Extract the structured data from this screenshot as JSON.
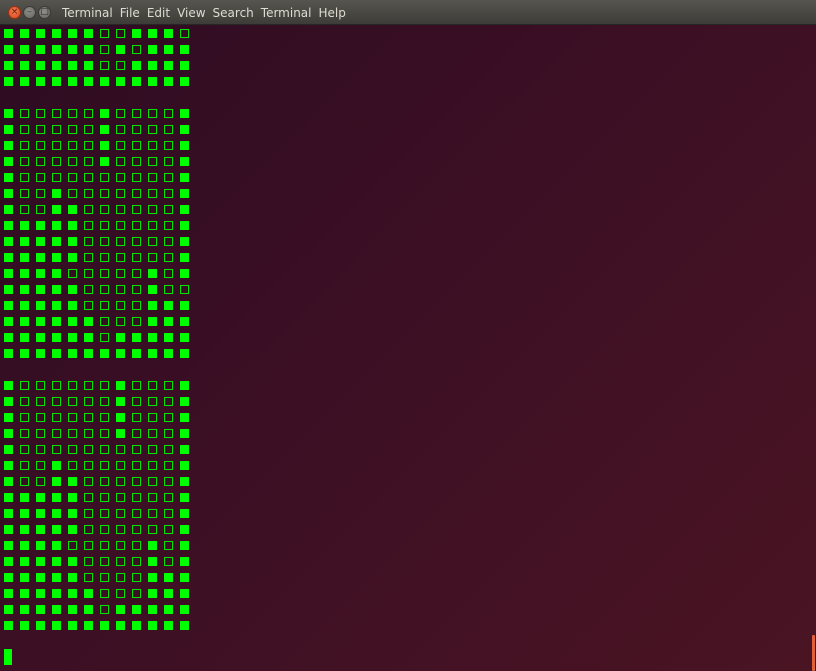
{
  "window": {
    "title_icons": {
      "close": "close-icon",
      "minimize": "minimize-icon",
      "maximize": "maximize-icon"
    }
  },
  "menubar": {
    "items": [
      "Terminal",
      "File",
      "Edit",
      "View",
      "Search",
      "Terminal",
      "Help"
    ]
  },
  "terminal": {
    "fg_color": "#00ff00",
    "blocks": [
      {
        "rows": [
          "111111001110",
          "111111010111",
          "111111001111",
          "111111111111"
        ]
      },
      {
        "rows": [
          "100000100001",
          "100000100001",
          "100000100001",
          "100000100001",
          "100000000001",
          "100100000001",
          "100110000001",
          "111110000001",
          "111110000001",
          "111110000001",
          "111100000101",
          "111110000100",
          "111110000111",
          "111111000111",
          "111111011111",
          "111111111111"
        ]
      },
      {
        "rows": [
          "100000010001",
          "100000010001",
          "100000010001",
          "100000010001",
          "100000000001",
          "100100000001",
          "100110000001",
          "111110000001",
          "111110000001",
          "111110000001",
          "111100000101",
          "111110000101",
          "111110000111",
          "111111000111",
          "111111011111",
          "111111111111"
        ]
      }
    ]
  }
}
